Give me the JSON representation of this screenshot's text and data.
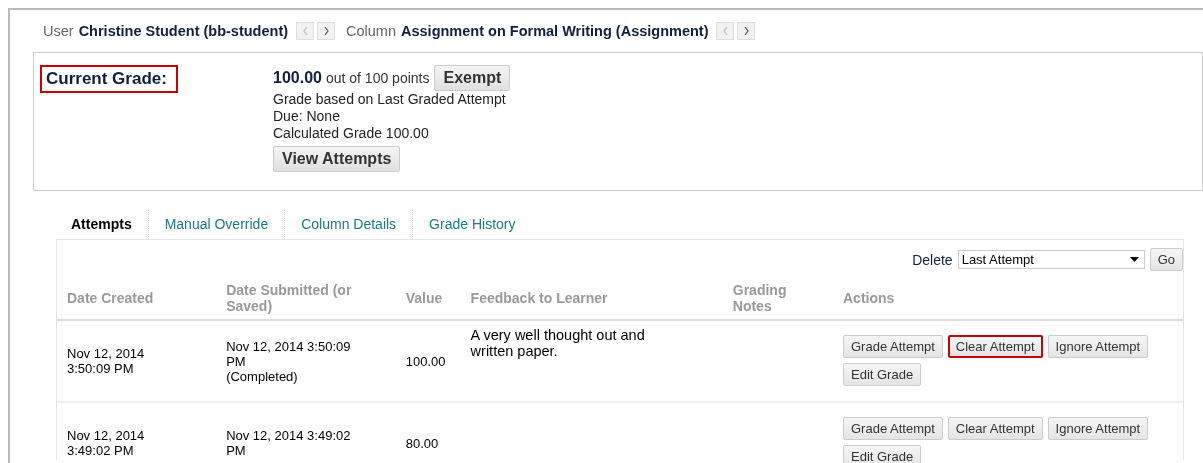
{
  "header": {
    "user_label": "User",
    "user": "Christine Student (bb-student)",
    "column_label": "Column",
    "column": "Assignment on Formal Writing (Assignment)"
  },
  "grade": {
    "label": "Current Grade:",
    "label_highlighted": true,
    "score": "100.00",
    "out_of": "out of 100 points",
    "exempt_button": "Exempt",
    "lines": [
      "Grade based on Last Graded Attempt",
      "Due: None",
      "Calculated Grade  100.00"
    ],
    "view_button": "View Attempts"
  },
  "tabs": [
    {
      "label": "Attempts",
      "selected": true
    },
    {
      "label": "Manual Override",
      "selected": false
    },
    {
      "label": "Column Details",
      "selected": false
    },
    {
      "label": "Grade History",
      "selected": false
    }
  ],
  "delete": {
    "label": "Delete",
    "value": "Last Attempt",
    "go": "Go"
  },
  "table": {
    "columns": [
      "Date Created",
      "Date Submitted (or Saved)",
      "Value",
      "Feedback to Learner",
      "Grading Notes",
      "Actions"
    ],
    "rows": [
      {
        "created": "Nov 12, 2014 3:50:09 PM",
        "submitted": [
          "Nov 12, 2014 3:50:09 PM",
          "(Completed)"
        ],
        "value": "100.00",
        "feedback": "A very well thought out and written paper.",
        "actions": [
          {
            "label": "Grade Attempt",
            "highlighted": false
          },
          {
            "label": "Clear Attempt",
            "highlighted": true
          },
          {
            "label": "Ignore Attempt",
            "highlighted": false
          },
          {
            "label": "Edit Grade",
            "highlighted": false
          }
        ]
      },
      {
        "created": "Nov 12, 2014 3:49:02 PM",
        "submitted": [
          "Nov 12, 2014 3:49:02 PM"
        ],
        "value": "80.00",
        "actions": [
          {
            "label": "Grade Attempt",
            "highlighted": false
          },
          {
            "label": "Clear Attempt",
            "highlighted": false
          },
          {
            "label": "Ignore Attempt",
            "highlighted": false
          },
          {
            "label": "Edit Grade",
            "highlighted": false
          }
        ]
      }
    ]
  }
}
